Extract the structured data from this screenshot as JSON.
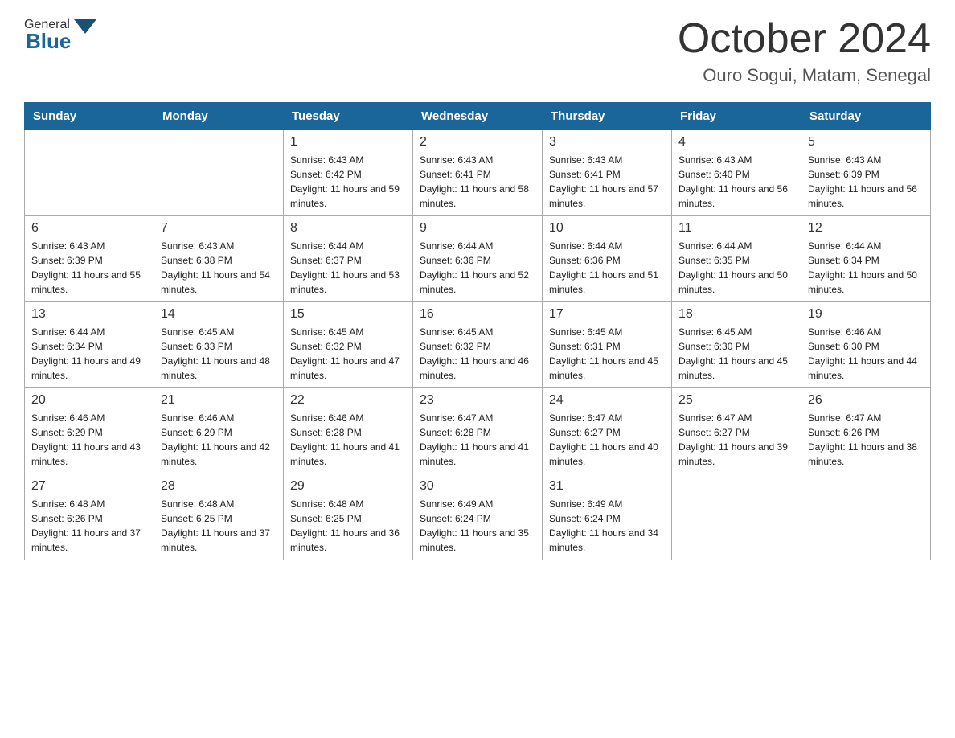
{
  "header": {
    "logo_general": "General",
    "logo_blue": "Blue",
    "month_title": "October 2024",
    "location": "Ouro Sogui, Matam, Senegal"
  },
  "days_of_week": [
    "Sunday",
    "Monday",
    "Tuesday",
    "Wednesday",
    "Thursday",
    "Friday",
    "Saturday"
  ],
  "weeks": [
    [
      {
        "day": "",
        "sunrise": "",
        "sunset": "",
        "daylight": ""
      },
      {
        "day": "",
        "sunrise": "",
        "sunset": "",
        "daylight": ""
      },
      {
        "day": "1",
        "sunrise": "6:43 AM",
        "sunset": "6:42 PM",
        "daylight": "11 hours and 59 minutes."
      },
      {
        "day": "2",
        "sunrise": "6:43 AM",
        "sunset": "6:41 PM",
        "daylight": "11 hours and 58 minutes."
      },
      {
        "day": "3",
        "sunrise": "6:43 AM",
        "sunset": "6:41 PM",
        "daylight": "11 hours and 57 minutes."
      },
      {
        "day": "4",
        "sunrise": "6:43 AM",
        "sunset": "6:40 PM",
        "daylight": "11 hours and 56 minutes."
      },
      {
        "day": "5",
        "sunrise": "6:43 AM",
        "sunset": "6:39 PM",
        "daylight": "11 hours and 56 minutes."
      }
    ],
    [
      {
        "day": "6",
        "sunrise": "6:43 AM",
        "sunset": "6:39 PM",
        "daylight": "11 hours and 55 minutes."
      },
      {
        "day": "7",
        "sunrise": "6:43 AM",
        "sunset": "6:38 PM",
        "daylight": "11 hours and 54 minutes."
      },
      {
        "day": "8",
        "sunrise": "6:44 AM",
        "sunset": "6:37 PM",
        "daylight": "11 hours and 53 minutes."
      },
      {
        "day": "9",
        "sunrise": "6:44 AM",
        "sunset": "6:36 PM",
        "daylight": "11 hours and 52 minutes."
      },
      {
        "day": "10",
        "sunrise": "6:44 AM",
        "sunset": "6:36 PM",
        "daylight": "11 hours and 51 minutes."
      },
      {
        "day": "11",
        "sunrise": "6:44 AM",
        "sunset": "6:35 PM",
        "daylight": "11 hours and 50 minutes."
      },
      {
        "day": "12",
        "sunrise": "6:44 AM",
        "sunset": "6:34 PM",
        "daylight": "11 hours and 50 minutes."
      }
    ],
    [
      {
        "day": "13",
        "sunrise": "6:44 AM",
        "sunset": "6:34 PM",
        "daylight": "11 hours and 49 minutes."
      },
      {
        "day": "14",
        "sunrise": "6:45 AM",
        "sunset": "6:33 PM",
        "daylight": "11 hours and 48 minutes."
      },
      {
        "day": "15",
        "sunrise": "6:45 AM",
        "sunset": "6:32 PM",
        "daylight": "11 hours and 47 minutes."
      },
      {
        "day": "16",
        "sunrise": "6:45 AM",
        "sunset": "6:32 PM",
        "daylight": "11 hours and 46 minutes."
      },
      {
        "day": "17",
        "sunrise": "6:45 AM",
        "sunset": "6:31 PM",
        "daylight": "11 hours and 45 minutes."
      },
      {
        "day": "18",
        "sunrise": "6:45 AM",
        "sunset": "6:30 PM",
        "daylight": "11 hours and 45 minutes."
      },
      {
        "day": "19",
        "sunrise": "6:46 AM",
        "sunset": "6:30 PM",
        "daylight": "11 hours and 44 minutes."
      }
    ],
    [
      {
        "day": "20",
        "sunrise": "6:46 AM",
        "sunset": "6:29 PM",
        "daylight": "11 hours and 43 minutes."
      },
      {
        "day": "21",
        "sunrise": "6:46 AM",
        "sunset": "6:29 PM",
        "daylight": "11 hours and 42 minutes."
      },
      {
        "day": "22",
        "sunrise": "6:46 AM",
        "sunset": "6:28 PM",
        "daylight": "11 hours and 41 minutes."
      },
      {
        "day": "23",
        "sunrise": "6:47 AM",
        "sunset": "6:28 PM",
        "daylight": "11 hours and 41 minutes."
      },
      {
        "day": "24",
        "sunrise": "6:47 AM",
        "sunset": "6:27 PM",
        "daylight": "11 hours and 40 minutes."
      },
      {
        "day": "25",
        "sunrise": "6:47 AM",
        "sunset": "6:27 PM",
        "daylight": "11 hours and 39 minutes."
      },
      {
        "day": "26",
        "sunrise": "6:47 AM",
        "sunset": "6:26 PM",
        "daylight": "11 hours and 38 minutes."
      }
    ],
    [
      {
        "day": "27",
        "sunrise": "6:48 AM",
        "sunset": "6:26 PM",
        "daylight": "11 hours and 37 minutes."
      },
      {
        "day": "28",
        "sunrise": "6:48 AM",
        "sunset": "6:25 PM",
        "daylight": "11 hours and 37 minutes."
      },
      {
        "day": "29",
        "sunrise": "6:48 AM",
        "sunset": "6:25 PM",
        "daylight": "11 hours and 36 minutes."
      },
      {
        "day": "30",
        "sunrise": "6:49 AM",
        "sunset": "6:24 PM",
        "daylight": "11 hours and 35 minutes."
      },
      {
        "day": "31",
        "sunrise": "6:49 AM",
        "sunset": "6:24 PM",
        "daylight": "11 hours and 34 minutes."
      },
      {
        "day": "",
        "sunrise": "",
        "sunset": "",
        "daylight": ""
      },
      {
        "day": "",
        "sunrise": "",
        "sunset": "",
        "daylight": ""
      }
    ]
  ],
  "labels": {
    "sunrise": "Sunrise:",
    "sunset": "Sunset:",
    "daylight": "Daylight:"
  }
}
